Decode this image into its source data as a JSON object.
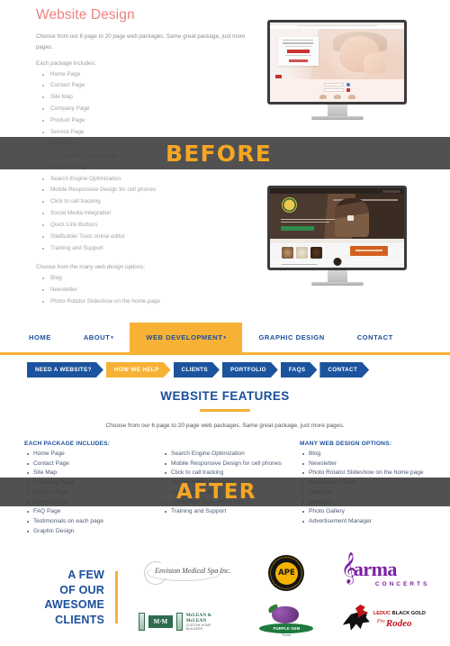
{
  "before": {
    "heading": "Website Design",
    "intro": "Choose from our 6 page to 20 page web packages. Same great package, just more pages.",
    "intro_em": "web packages",
    "subhead": "Each package includes:",
    "package_items": [
      "Home Page",
      "Contact Page",
      "Site Map",
      "Company Page",
      "Product Page",
      "Service Page",
      "FAQ Page",
      "Testimonials on each page",
      "Graphic Design",
      "Search Engine Optimization",
      "Mobile Responsive Design for cell phones",
      "Click to call tracking",
      "Social Media Integration",
      "Quick Link Buttons",
      "SiteBuilder Tools online editor",
      "Training and Support"
    ],
    "options_lead": "Choose from the many web design options:",
    "options_em": "web design",
    "option_items": [
      "Blog",
      "Newsletter",
      "Photo Rotator Slideshow on the home page"
    ],
    "ribbon_label": "BEFORE",
    "monitor_1_name": "medical-spa-website-mockup",
    "monitor_2_name": "coffee-shop-website-mockup"
  },
  "after": {
    "ribbon_label": "AFTER",
    "main_nav": [
      {
        "label": "HOME",
        "caret": false,
        "active": false
      },
      {
        "label": "ABOUT",
        "caret": true,
        "active": false
      },
      {
        "label": "WEB DEVELOPMENT",
        "caret": true,
        "active": true
      },
      {
        "label": "GRAPHIC DESIGN",
        "caret": false,
        "active": false
      },
      {
        "label": "CONTACT",
        "caret": false,
        "active": false
      }
    ],
    "breadcrumbs": [
      {
        "label": "NEED A WEBSITE?",
        "active": false
      },
      {
        "label": "HOW WE HELP",
        "active": true
      },
      {
        "label": "CLIENTS",
        "active": false
      },
      {
        "label": "PORTFOLIO",
        "active": false
      },
      {
        "label": "FAQS",
        "active": false
      },
      {
        "label": "CONTACT",
        "active": false
      }
    ],
    "features_title": "WEBSITE FEATURES",
    "features_lead": "Choose from our 6 page to 20 page web packages. Same great package, just more pages.",
    "columns": [
      {
        "heading": "EACH PACKAGE INCLUDES:",
        "items": [
          "Home Page",
          "Contact Page",
          "Site Map",
          "Company Page",
          "Product Page",
          "Service Page",
          "FAQ Page",
          "Testimonials on each page",
          "Graphic Design"
        ]
      },
      {
        "heading": "",
        "items": [
          "Search Engine Optimization",
          "Mobile Responsive Design for cell phones",
          "Click to call tracking",
          "Social Media Integration",
          "Quick Link Buttons",
          "SiteBuilder Tools online editor",
          "Training and Support"
        ]
      },
      {
        "heading": "MANY WEB DESIGN OPTIONS:",
        "items": [
          "Blog",
          "Newsletter",
          "Photo Rotator Slideshow on the home page",
          "eCommerce Store",
          "Calendar",
          "Directory",
          "Photo Gallery",
          "Advertisement Manager"
        ]
      }
    ],
    "clients": {
      "title_lines": [
        "A FEW",
        "OF OUR",
        "AWESOME",
        "CLIENTS"
      ],
      "logos": [
        {
          "name": "envision-medical-spa",
          "text": "Envision Medical Spa Inc."
        },
        {
          "name": "ape-canada",
          "text": "APE"
        },
        {
          "name": "karma-concerts",
          "text": "arma",
          "sub": "CONCERTS"
        },
        {
          "name": "mclean-and-mclean",
          "text": "M·M",
          "line1": "McLEAN & McLEAN",
          "line2": "CUSTOM HOME BUILDERS"
        },
        {
          "name": "purple-gem-farms",
          "text": "PURPLE GEM",
          "sub": "Farms"
        },
        {
          "name": "leduc-black-gold-pro-rodeo",
          "line1_a": "LEDUC",
          "line1_b": " BLACK GOLD",
          "line2_a": "Pro",
          "line2_b": "Rodeo"
        }
      ]
    }
  },
  "colors": {
    "coral": "#f0827e",
    "orange": "#f7b236",
    "blue": "#1b4f9c",
    "crumb_blue": "#1b539e",
    "ribbon_dark": "#3e3e3e",
    "body_text": "#4b5a74"
  }
}
